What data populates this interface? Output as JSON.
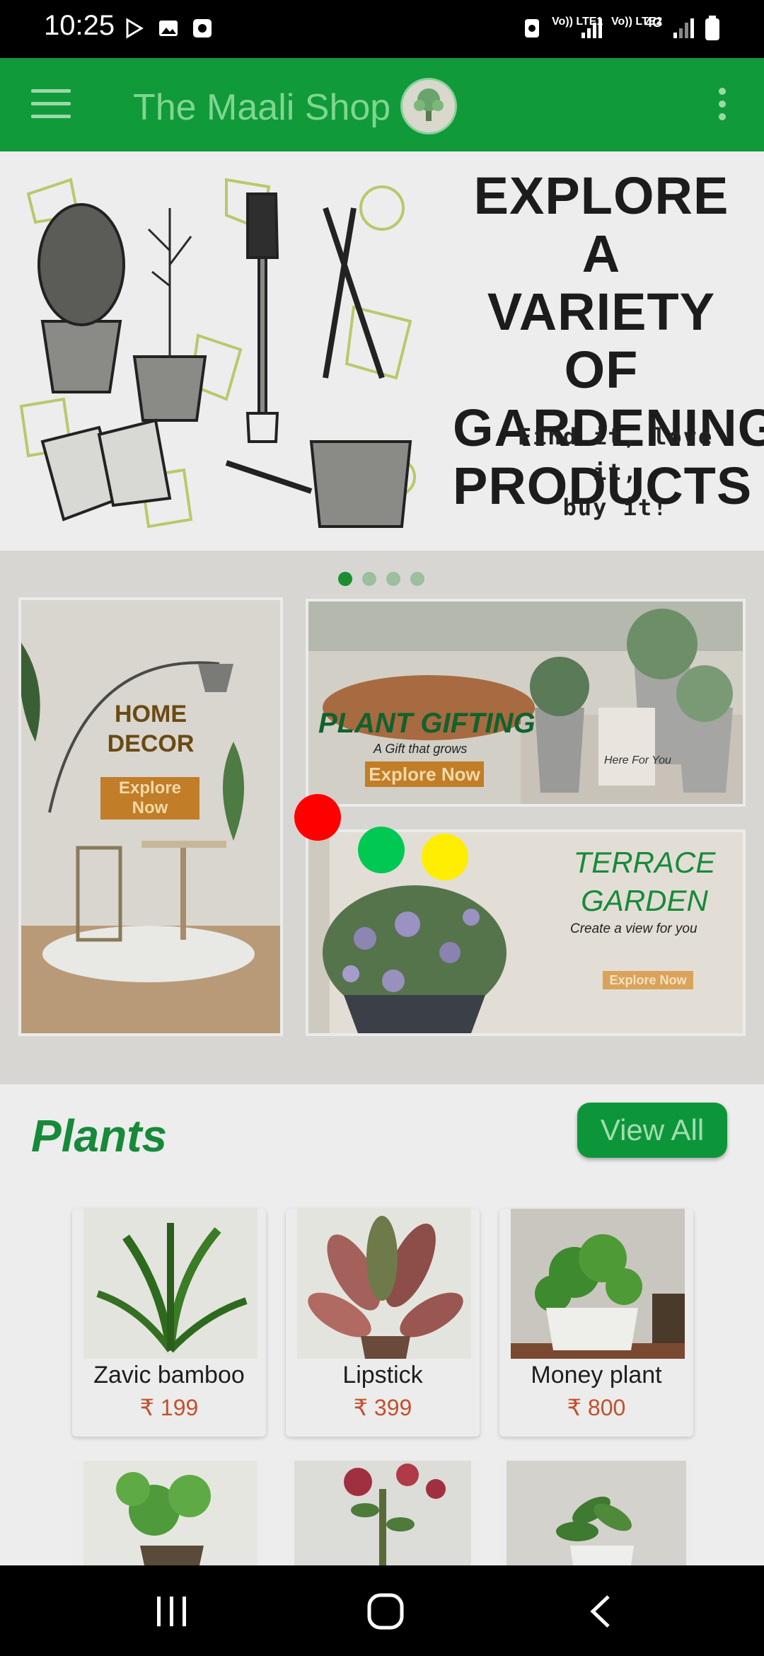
{
  "status_bar": {
    "time": "10:25",
    "net1": "Vo)) LTE1",
    "net2": "Vo)) LTE2",
    "net3": "4G"
  },
  "app_bar": {
    "title": "The Maali Shop"
  },
  "banner": {
    "headline": [
      "EXPLORE A",
      "VARIETY OF",
      "GARDENING",
      "PRODUCTS"
    ],
    "subtitle": [
      "Find it, love it,",
      "buy it!"
    ],
    "carousel_count": 4,
    "carousel_active": 1
  },
  "promos": {
    "home_decor": {
      "title": [
        "HOME",
        "DECOR"
      ],
      "button": [
        "Explore",
        "Now"
      ]
    },
    "plant_gifting": {
      "title": "PLANT GIFTING",
      "tagline": "A Gift that grows",
      "button": "Explore Now",
      "card_text": "Here For You"
    },
    "terrace_garden": {
      "title": [
        "TERRACE",
        "GARDEN"
      ],
      "tagline": "Create a view for you",
      "button": "Explore Now"
    }
  },
  "plants": {
    "title": "Plants",
    "view_all": "View All",
    "items": [
      {
        "name": "Zavic bamboo",
        "price": "₹ 199"
      },
      {
        "name": "Lipstick",
        "price": "₹ 399"
      },
      {
        "name": "Money plant",
        "price": "₹ 800"
      }
    ]
  },
  "colors": {
    "brand_green": "#109a3a",
    "price": "#c2502e",
    "marker_red": "#ff0000",
    "marker_green": "#00c853",
    "marker_yellow": "#ffee00"
  }
}
